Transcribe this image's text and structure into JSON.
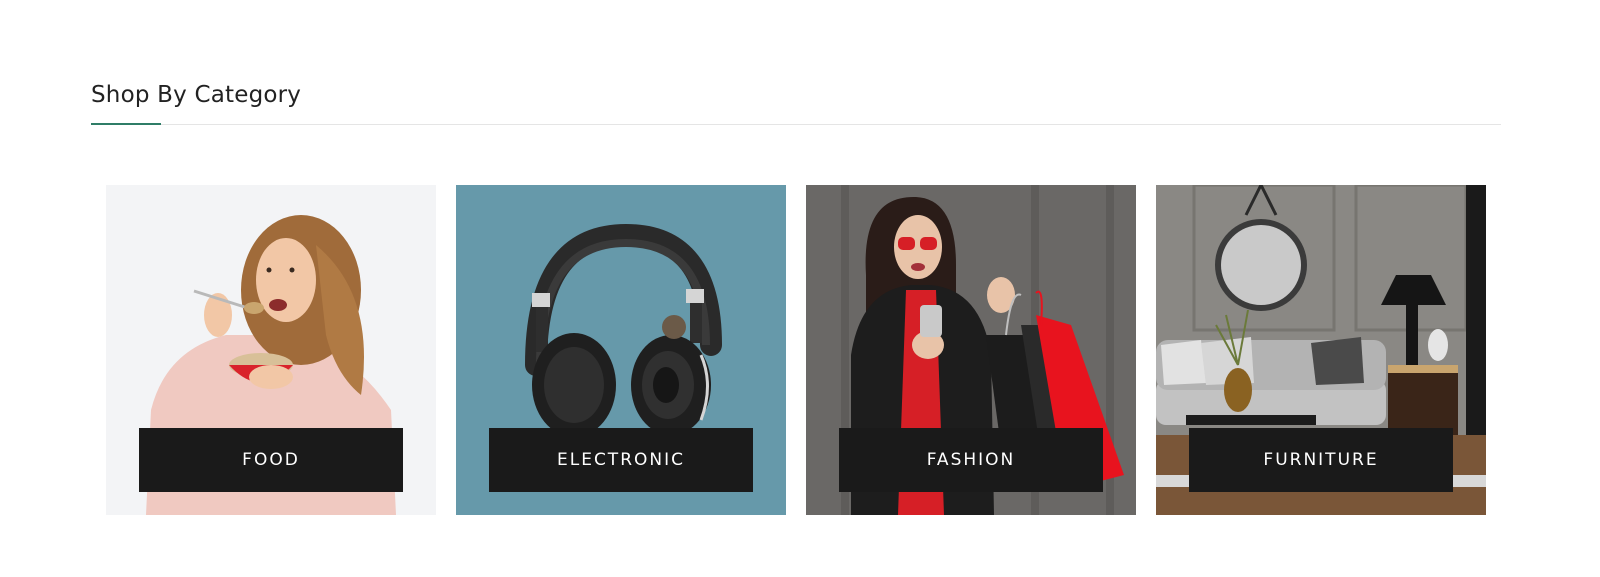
{
  "section": {
    "title": "Shop By Category",
    "accent_color": "#2f7d67"
  },
  "categories": [
    {
      "label": "FOOD",
      "image": "woman-eating-cereal-image",
      "background": "#f3f4f6"
    },
    {
      "label": "ELECTRONIC",
      "image": "headphones-image",
      "background": "#6699aa"
    },
    {
      "label": "FASHION",
      "image": "woman-shopping-bags-image",
      "background": "#6a6866"
    },
    {
      "label": "FURNITURE",
      "image": "living-room-image",
      "background": "#8a8884"
    }
  ]
}
